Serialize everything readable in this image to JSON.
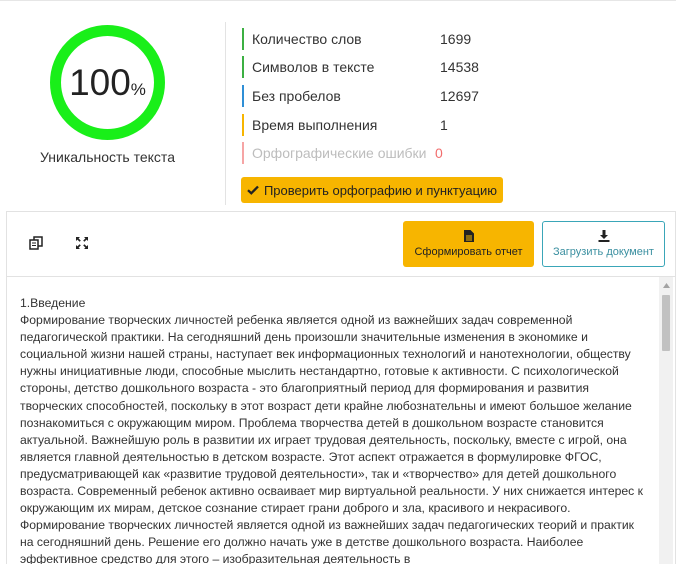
{
  "uniqueness": {
    "percent_number": "100",
    "percent_sign": "%",
    "value": 100,
    "label": "Уникальность текста",
    "ring_color": "#19ef19"
  },
  "stats": [
    {
      "label": "Количество слов",
      "value": "1699",
      "color": "#3cb043"
    },
    {
      "label": "Символов в тексте",
      "value": "14538",
      "color": "#3cb043"
    },
    {
      "label": "Без пробелов",
      "value": "12697",
      "color": "#2f8fd6"
    },
    {
      "label": "Время выполнения",
      "value": "1",
      "color": "#f7b500"
    },
    {
      "label": "Орфографические ошибки",
      "value": "0",
      "color": "#f6a5a5"
    }
  ],
  "check_button": {
    "label": "Проверить орфографию и пунктуацию",
    "icon": "checkmark-icon"
  },
  "toolbar": {
    "copy_icon": "copy-icon",
    "expand_icon": "expand-icon",
    "report_button": {
      "label": "Сформировать отчет",
      "icon": "document-icon"
    },
    "upload_button": {
      "label": "Загрузить документ",
      "icon": "download-icon"
    }
  },
  "document": {
    "paragraphs": [
      "1.Введение",
      "Формирование творческих личностей ребенка является одной из важнейших задач современной педагогической практики. На сегодняшний день произошли значительные изменения в экономике и социальной жизни нашей страны, наступает век информационных технологий и нанотехнологии, обществу нужны инициативные люди, способные мыслить нестандартно, готовые к активности. С психологической стороны, детство дошкольного возраста - это благоприятный период для формирования и развития творческих способностей, поскольку в этот возраст дети крайне любознательны и имеют большое желание познакомиться с окружающим миром. Проблема творчества детей в дошкольном возрасте становится актуальной. Важнейшую роль в развитии их играет трудовая деятельность, поскольку, вместе с игрой, она является главной деятельностью в детском возрасте. Этот аспект отражается в формулировке ФГОС, предусматривающей как «развитие трудовой деятельности», так и «творчество» для детей дошкольного возраста. Современный ребенок активно осваивает мир виртуальной реальности. У них снижается интерес к окружающим их мирам, детское сознание стирает грани доброго и зла, красивого и некрасивого. Формирование творческих личностей является одной из важнейших задач педагогических теорий и практик на сегодняшний день. Решение его должно начать уже в детстве дошкольного возраста. Наиболее эффективное средство для этого – изобразительная деятельность в"
    ]
  },
  "colors": {
    "accent": "#f7b500",
    "teal": "#3aa6b8"
  }
}
